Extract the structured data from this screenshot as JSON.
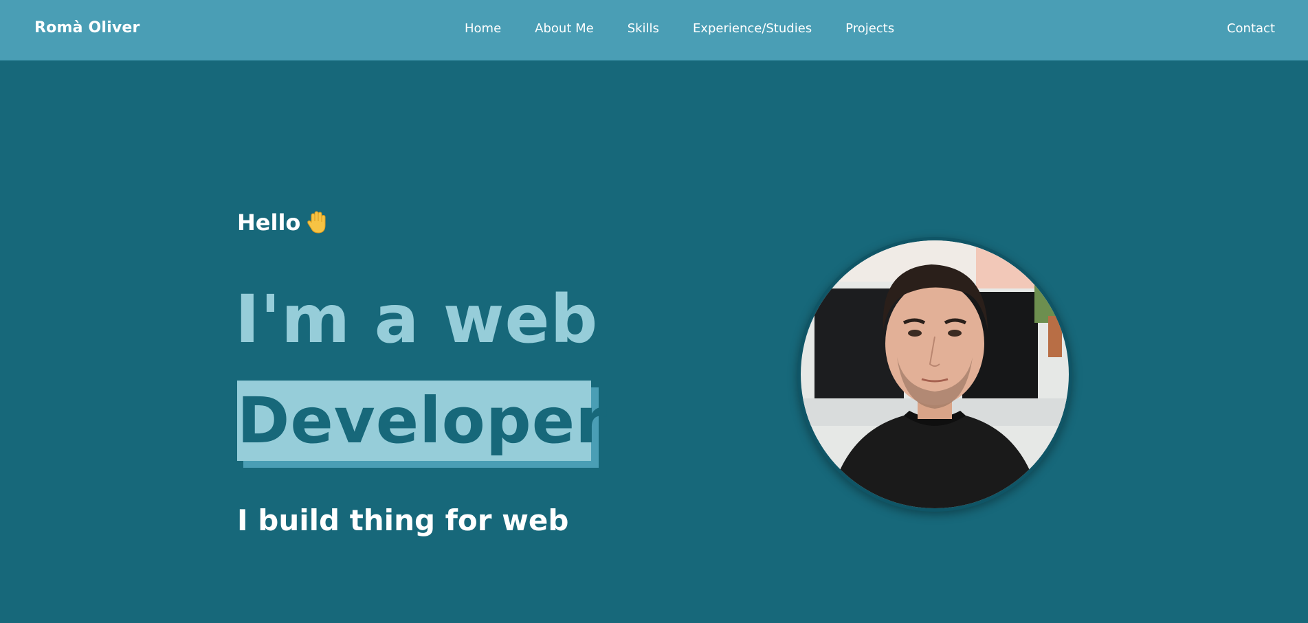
{
  "navbar": {
    "brand": "Romà Oliver",
    "links": [
      {
        "label": "Home"
      },
      {
        "label": "About Me"
      },
      {
        "label": "Skills"
      },
      {
        "label": "Experience/Studies"
      },
      {
        "label": "Projects"
      }
    ],
    "contact": "Contact"
  },
  "hero": {
    "greeting": "Hello",
    "greeting_icon": "waving-hand-icon",
    "headline_line1": "I'm a web",
    "headline_line2": "Developer",
    "tagline": "I build thing for web",
    "avatar_icon": "profile-photo"
  },
  "colors": {
    "navbar_bg": "#4a9eb5",
    "page_bg": "#17687a",
    "accent_light": "#96cdd9",
    "text_white": "#ffffff"
  }
}
